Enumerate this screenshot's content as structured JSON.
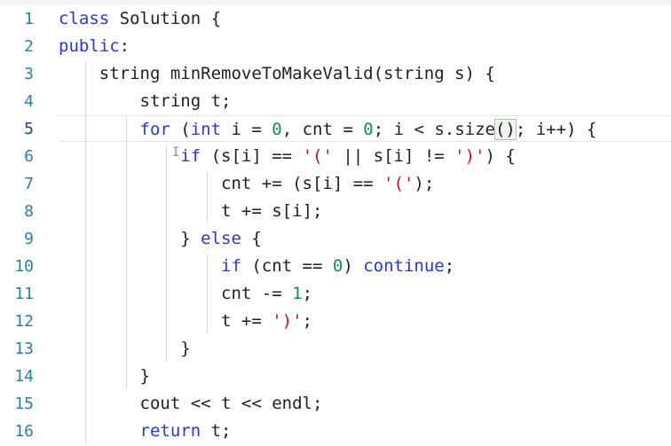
{
  "editor": {
    "lines": [
      {
        "num": "1",
        "tokens": [
          [
            "class",
            "kw"
          ],
          [
            " Solution {",
            ""
          ]
        ]
      },
      {
        "num": "2",
        "tokens": [
          [
            "public",
            "kw"
          ],
          [
            ":",
            ""
          ]
        ]
      },
      {
        "num": "3",
        "tokens": [
          [
            "    string minRemoveToMakeValid(string s) {",
            ""
          ]
        ]
      },
      {
        "num": "4",
        "tokens": [
          [
            "        string t;",
            ""
          ]
        ]
      },
      {
        "num": "5",
        "tokens": [
          [
            "        ",
            ""
          ],
          [
            "for",
            "kw"
          ],
          [
            " (",
            ""
          ],
          [
            "int",
            "kw"
          ],
          [
            " i = ",
            ""
          ],
          [
            "0",
            "num"
          ],
          [
            ", cnt = ",
            ""
          ],
          [
            "0",
            "num"
          ],
          [
            "; i < s.size",
            ""
          ],
          [
            "()",
            "bracket"
          ],
          [
            "; i++) {",
            ""
          ]
        ]
      },
      {
        "num": "6",
        "tokens": [
          [
            "            ",
            ""
          ],
          [
            "if",
            "kw"
          ],
          [
            " (s[i] == ",
            ""
          ],
          [
            "'('",
            "str"
          ],
          [
            " || s[i] != ",
            ""
          ],
          [
            "')'",
            "str"
          ],
          [
            ") {",
            ""
          ]
        ]
      },
      {
        "num": "7",
        "tokens": [
          [
            "                cnt += (s[i] == ",
            ""
          ],
          [
            "'('",
            "str"
          ],
          [
            ");",
            ""
          ]
        ]
      },
      {
        "num": "8",
        "tokens": [
          [
            "                t += s[i];",
            ""
          ]
        ]
      },
      {
        "num": "9",
        "tokens": [
          [
            "            } ",
            ""
          ],
          [
            "else",
            "kw"
          ],
          [
            " {",
            ""
          ]
        ]
      },
      {
        "num": "10",
        "tokens": [
          [
            "                ",
            ""
          ],
          [
            "if",
            "kw"
          ],
          [
            " (cnt == ",
            ""
          ],
          [
            "0",
            "num"
          ],
          [
            ") ",
            ""
          ],
          [
            "continue",
            "kw"
          ],
          [
            ";",
            ""
          ]
        ]
      },
      {
        "num": "11",
        "tokens": [
          [
            "                cnt -= ",
            ""
          ],
          [
            "1",
            "num"
          ],
          [
            ";",
            ""
          ]
        ]
      },
      {
        "num": "12",
        "tokens": [
          [
            "                t += ",
            ""
          ],
          [
            "')'",
            "str"
          ],
          [
            ";",
            ""
          ]
        ]
      },
      {
        "num": "13",
        "tokens": [
          [
            "            }",
            ""
          ]
        ]
      },
      {
        "num": "14",
        "tokens": [
          [
            "        }",
            ""
          ]
        ]
      },
      {
        "num": "15",
        "tokens": [
          [
            "        cout << t << endl;",
            ""
          ]
        ]
      },
      {
        "num": "16",
        "tokens": [
          [
            "        ",
            ""
          ],
          [
            "return",
            "kw"
          ],
          [
            " t;",
            ""
          ]
        ]
      }
    ],
    "current_line": 5,
    "colors": {
      "keyword": "#2a39c8",
      "number": "#128c5e",
      "string": "#c4122c",
      "line_number": "#2a7fa8",
      "text": "#1f1f1f"
    }
  }
}
